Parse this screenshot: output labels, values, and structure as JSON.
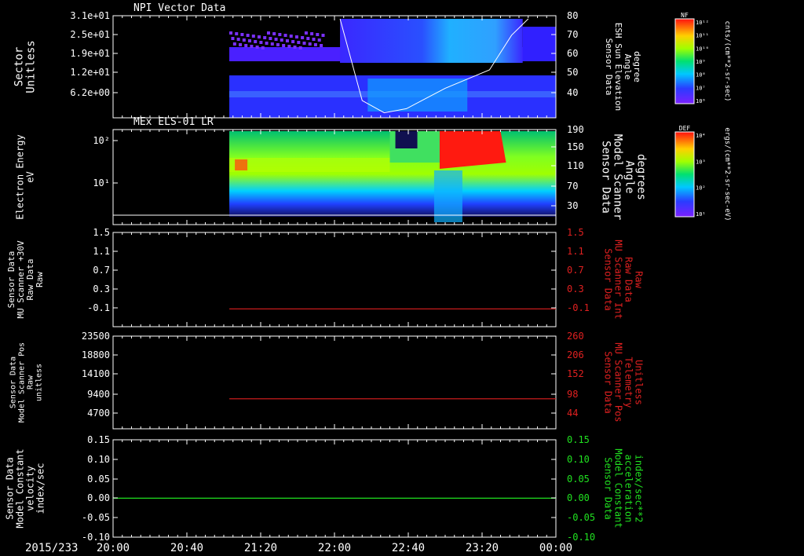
{
  "date_label": "2015/233",
  "x_ticks": [
    "20:00",
    "20:40",
    "21:20",
    "22:00",
    "22:40",
    "23:20",
    "00:00"
  ],
  "colors": {
    "background": "#000000",
    "axes": "#ffffff",
    "red_trace": "#e02020",
    "green_trace": "#20e020",
    "elevation_line": "#ffffff"
  },
  "chart_data": [
    {
      "type": "heatmap",
      "title": "NPI Vector Data",
      "ylabel_left": [
        "Sector",
        "Unitless"
      ],
      "yticks_left": [
        "3.1e+01",
        "2.5e+01",
        "1.9e+01",
        "1.2e+01",
        "6.2e+00"
      ],
      "ylabel_right": [
        "Sensor Data",
        "ESH Sun Elevation",
        "Angle",
        "degree"
      ],
      "yticks_right": [
        "80",
        "70",
        "60",
        "50",
        "40"
      ],
      "colorbar": {
        "label": "NF",
        "unit": "cnts/(cm**2-sr-sec)",
        "ticks": [
          "10¹²",
          "10¹¹",
          "10¹⁰",
          "10⁹",
          "10⁸",
          "10⁷",
          "10⁶"
        ]
      },
      "elevation_line": {
        "x": [
          22.05,
          22.25,
          22.45,
          22.65,
          23.0,
          23.4,
          23.6,
          23.75
        ],
        "y": [
          80,
          40,
          34,
          36,
          46,
          55,
          72,
          80
        ]
      }
    },
    {
      "type": "heatmap",
      "title": "MEx ELS-01 LR",
      "ylabel_left": [
        "Electron Energy",
        "eV"
      ],
      "yticks_left": [
        "10²",
        "10¹"
      ],
      "ylabel_right": [
        "Sensor Data",
        "Model Scanner",
        "Angle",
        "degrees"
      ],
      "yticks_right": [
        "190",
        "150",
        "110",
        "70",
        "30"
      ],
      "colorbar": {
        "label": "DEF",
        "unit": "ergs/(cm**2-sr-sec-eV)",
        "ticks": [
          "10⁴",
          "10³",
          "10²",
          "10¹"
        ]
      }
    },
    {
      "type": "line",
      "ylabel_left": [
        "Sensor Data",
        "MU Scanner +30V",
        "Raw Data",
        "Raw"
      ],
      "yticks_left": [
        "1.5",
        "1.1",
        "0.7",
        "0.3",
        "-0.1"
      ],
      "ylabel_right": [
        "Sensor Data",
        "MU Scanner Int",
        "Raw Data",
        "Raw"
      ],
      "yticks_right": [
        "1.5",
        "1.1",
        "0.7",
        "0.3",
        "-0.1"
      ],
      "ylim": [
        -0.35,
        1.5
      ],
      "series": [
        {
          "x": [
            21.05,
            24.0
          ],
          "y": [
            0,
            0
          ]
        }
      ]
    },
    {
      "type": "line",
      "ylabel_left": [
        "Sensor Data",
        "Model Scanner Pos",
        "Raw",
        "unitless"
      ],
      "yticks_left": [
        "23500",
        "18800",
        "14100",
        "9400",
        "4700"
      ],
      "ylabel_right": [
        "Sensor Data",
        "MU Scanner Pos",
        "Telemetry",
        "Unitless"
      ],
      "yticks_right": [
        "260",
        "206",
        "152",
        "98",
        "44"
      ],
      "ylim": [
        0,
        23500
      ],
      "series": [
        {
          "x": [
            21.05,
            24.0
          ],
          "y": [
            7600,
            7600
          ]
        }
      ]
    },
    {
      "type": "line",
      "ylabel_left": [
        "Sensor Data",
        "Model Constant",
        "velocity",
        "index/sec"
      ],
      "yticks_left": [
        "0.15",
        "0.10",
        "0.05",
        "0.00",
        "-0.05",
        "-0.10"
      ],
      "ylabel_right": [
        "Sensor Data",
        "Model Constant",
        "acceleration",
        "index/sec**2"
      ],
      "yticks_right": [
        "0.15",
        "0.10",
        "0.05",
        "0.00",
        "-0.05",
        "-0.10"
      ],
      "ylim": [
        -0.1,
        0.15
      ],
      "series": [
        {
          "x": [
            20.0,
            24.0
          ],
          "y": [
            0,
            0
          ]
        }
      ]
    }
  ]
}
